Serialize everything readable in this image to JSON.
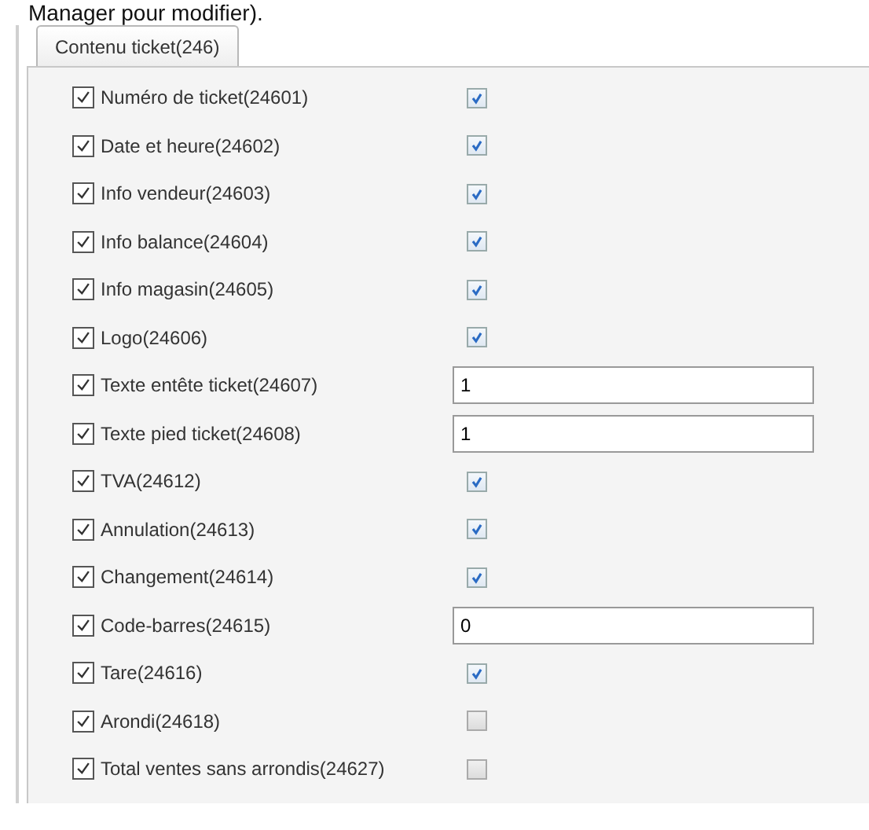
{
  "header_text": "Manager pour modifier).",
  "tabs": [
    {
      "label": "Contenu ticket(246)",
      "selected": true
    }
  ],
  "rows": [
    {
      "label": "Numéro de ticket(24601)",
      "checked": true,
      "kind": "checkbox",
      "value_checked": true
    },
    {
      "label": "Date et heure(24602)",
      "checked": true,
      "kind": "checkbox",
      "value_checked": true
    },
    {
      "label": "Info vendeur(24603)",
      "checked": true,
      "kind": "checkbox",
      "value_checked": true
    },
    {
      "label": "Info balance(24604)",
      "checked": true,
      "kind": "checkbox",
      "value_checked": true
    },
    {
      "label": "Info magasin(24605)",
      "checked": true,
      "kind": "checkbox",
      "value_checked": true
    },
    {
      "label": "Logo(24606)",
      "checked": true,
      "kind": "checkbox",
      "value_checked": true
    },
    {
      "label": "Texte entête ticket(24607)",
      "checked": true,
      "kind": "field",
      "value": "1"
    },
    {
      "label": "Texte pied ticket(24608)",
      "checked": true,
      "kind": "field",
      "value": "1"
    },
    {
      "label": "TVA(24612)",
      "checked": true,
      "kind": "checkbox",
      "value_checked": true
    },
    {
      "label": "Annulation(24613)",
      "checked": true,
      "kind": "checkbox",
      "value_checked": true
    },
    {
      "label": "Changement(24614)",
      "checked": true,
      "kind": "checkbox",
      "value_checked": true
    },
    {
      "label": "Code-barres(24615)",
      "checked": true,
      "kind": "field",
      "value": "0"
    },
    {
      "label": "Tare(24616)",
      "checked": true,
      "kind": "checkbox",
      "value_checked": true
    },
    {
      "label": "Arondi(24618)",
      "checked": true,
      "kind": "checkbox",
      "value_checked": false
    },
    {
      "label": "Total ventes sans arrondis(24627)",
      "checked": true,
      "kind": "checkbox",
      "value_checked": false
    }
  ]
}
